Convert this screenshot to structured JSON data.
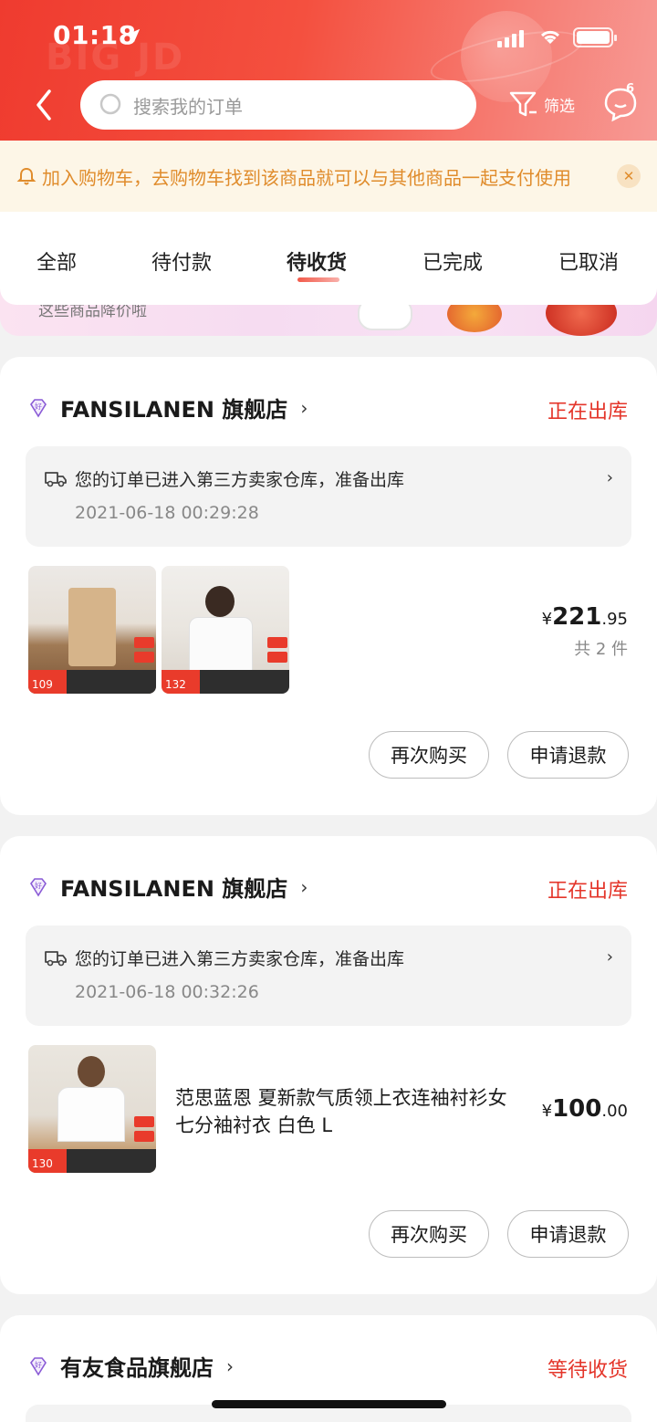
{
  "status_bar": {
    "time": "01:18"
  },
  "header": {
    "bg_word": "BIG JD",
    "search_placeholder": "搜索我的订单",
    "filter_label": "筛选",
    "message_badge": "6"
  },
  "notice": {
    "text": "加入购物车，去购物车找到该商品就可以与其他商品一起支付使用",
    "close": "✕"
  },
  "tabs": [
    {
      "label": "全部",
      "active": false
    },
    {
      "label": "待付款",
      "active": false
    },
    {
      "label": "待收货",
      "active": true
    },
    {
      "label": "已完成",
      "active": false
    },
    {
      "label": "已取消",
      "active": false
    }
  ],
  "banner": {
    "text": "这些商品降价啦"
  },
  "orders": [
    {
      "shop_badge": "好",
      "shop": "FANSILANEN 旗舰店",
      "status": "正在出库",
      "tracking": "您的订单已进入第三方卖家仓库，准备出库",
      "time": "2021-06-18 00:29:28",
      "thumb_prices": [
        "109",
        "132"
      ],
      "currency": "¥",
      "price_int": "221",
      "price_dec": ".95",
      "count": "共 2 件",
      "buttons": [
        "再次购买",
        "申请退款"
      ]
    },
    {
      "shop_badge": "好",
      "shop": "FANSILANEN 旗舰店",
      "status": "正在出库",
      "tracking": "您的订单已进入第三方卖家仓库，准备出库",
      "time": "2021-06-18 00:32:26",
      "thumb_prices": [
        "130"
      ],
      "title": "范思蓝恩 夏新款气质领上衣连袖衬衫女七分袖衬衣 白色 L",
      "currency": "¥",
      "price_int": "100",
      "price_dec": ".00",
      "buttons": [
        "再次购买",
        "申请退款"
      ]
    },
    {
      "shop_badge": "好",
      "shop": "有友食品旗舰店",
      "status": "等待收货"
    }
  ],
  "colors": {
    "accent": "#e4352a",
    "header": "#ef3b2f",
    "notice_text": "#e08c2c"
  }
}
